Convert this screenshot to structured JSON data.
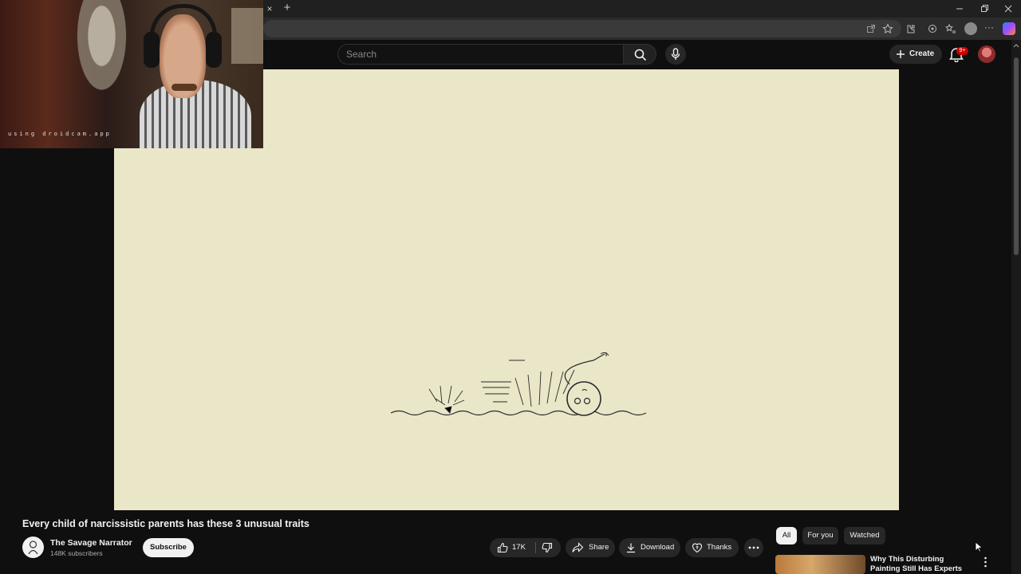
{
  "browser": {
    "new_tab_label": "+",
    "close_tab_glyph": "×",
    "window_controls": [
      "minimize",
      "restore",
      "close"
    ]
  },
  "masthead": {
    "search_placeholder": "Search",
    "create_label": "Create",
    "notification_count": "9+"
  },
  "webcam": {
    "overlay_text": "using droidcam.app"
  },
  "video": {
    "title": "Every child of narcissistic parents has these 3 unusual traits",
    "background_color": "#eae6c8"
  },
  "channel": {
    "name": "The Savage Narrator",
    "subscribers": "148K subscribers",
    "subscribe_label": "Subscribe"
  },
  "actions": {
    "likes": "17K",
    "share_label": "Share",
    "download_label": "Download",
    "thanks_label": "Thanks"
  },
  "chips": [
    "All",
    "For you",
    "Watched"
  ],
  "recommendation": {
    "title": "Why This Disturbing Painting Still Has Experts Debating Aft..."
  },
  "colors": {
    "page_bg": "#0f0f0f",
    "accent_red": "#cc0000",
    "pill_bg": "#272727"
  }
}
